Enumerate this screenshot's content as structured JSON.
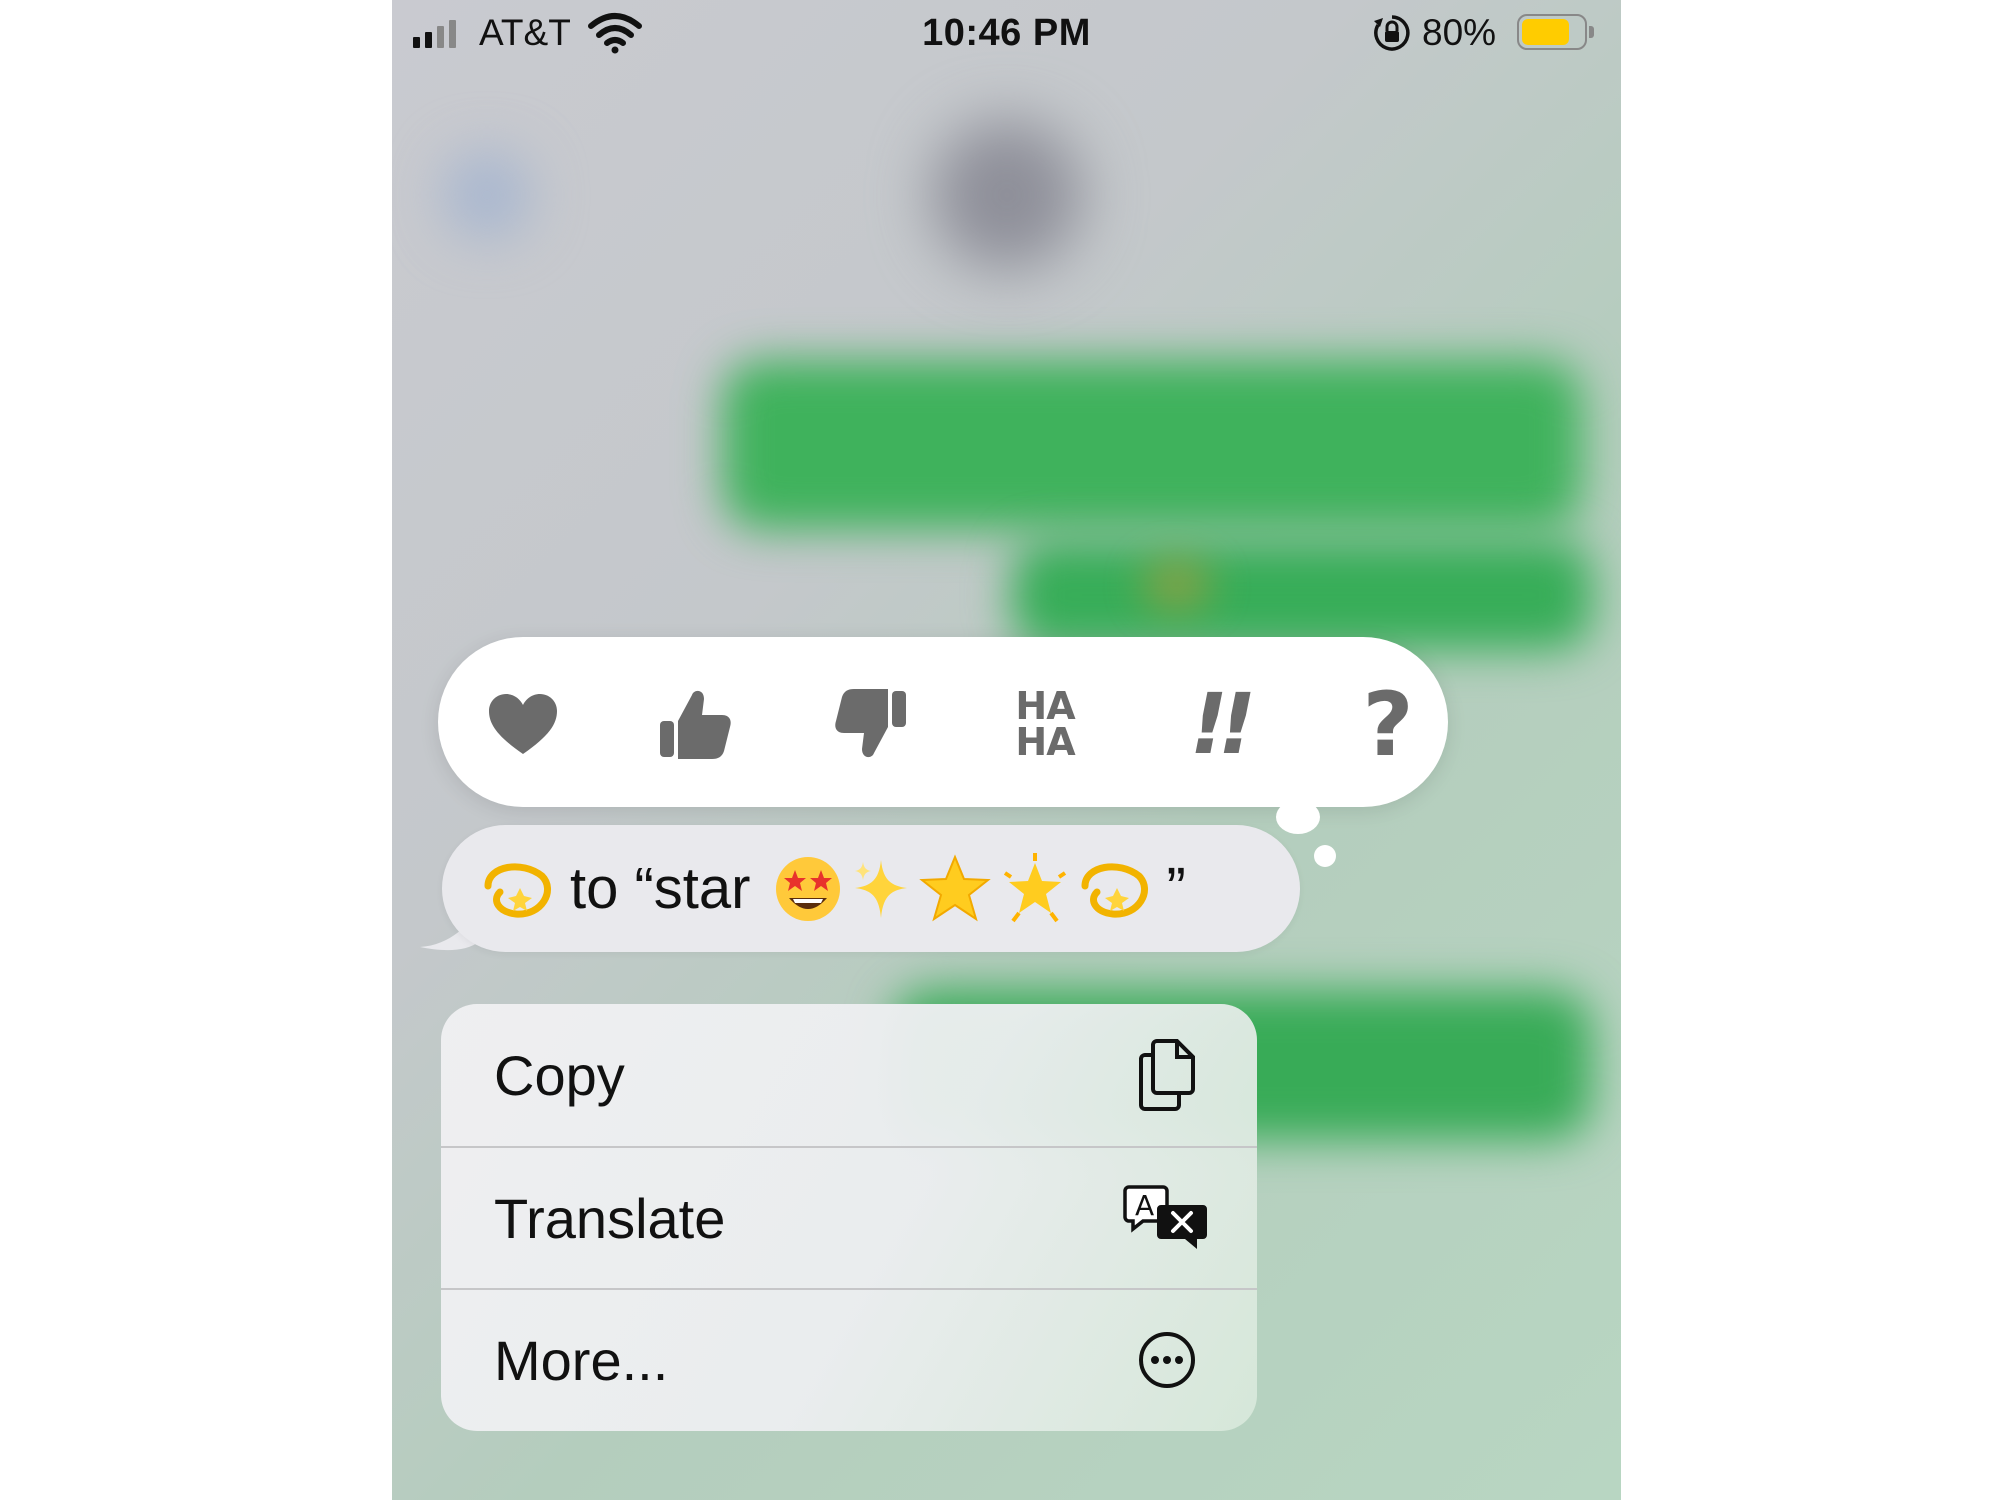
{
  "status_bar": {
    "carrier": "AT&T",
    "time": "10:46 PM",
    "battery_percent": "80%",
    "battery_level": 0.8,
    "signal_bars": 2,
    "colors": {
      "battery_fill": "#ffcc00"
    }
  },
  "tapback": {
    "reactions": [
      {
        "name": "heart",
        "icon": "heart-icon"
      },
      {
        "name": "thumbs-up",
        "icon": "thumbs-up-icon"
      },
      {
        "name": "thumbs-down",
        "icon": "thumbs-down-icon"
      },
      {
        "name": "haha",
        "icon": "haha-icon",
        "line1": "HA",
        "line2": "HA"
      },
      {
        "name": "emphasize",
        "icon": "double-exclamation-icon",
        "text": "!!"
      },
      {
        "name": "question",
        "icon": "question-mark-icon",
        "text": "?"
      }
    ]
  },
  "message": {
    "text_prefix": "to “star",
    "text_suffix": "”",
    "emojis": [
      "dizzy-icon",
      "star-struck-icon",
      "sparkles-icon",
      "star-icon",
      "glowing-star-icon",
      "dizzy-icon"
    ]
  },
  "menu": {
    "items": [
      {
        "label": "Copy",
        "icon": "copy-icon"
      },
      {
        "label": "Translate",
        "icon": "translate-icon"
      },
      {
        "label": "More...",
        "icon": "more-icon"
      }
    ]
  }
}
